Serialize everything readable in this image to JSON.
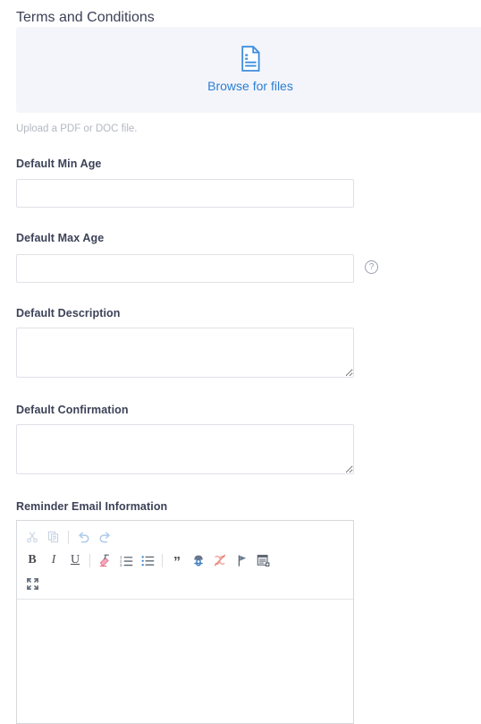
{
  "form": {
    "terms": {
      "label": "Terms and Conditions",
      "dropzone_label": "Browse for files",
      "dropzone_icon": "document-icon",
      "help_text": "Upload a PDF or DOC file.",
      "accent_color": "#2b7fd4",
      "dropzone_background": "#f4f5fa"
    },
    "min_age": {
      "label": "Default Min Age",
      "value": "",
      "placeholder": ""
    },
    "max_age": {
      "label": "Default Max Age",
      "value": "",
      "placeholder": "",
      "help_icon": "question-mark-circle-icon"
    },
    "description": {
      "label": "Default Description",
      "value": "",
      "placeholder": ""
    },
    "confirmation": {
      "label": "Default Confirmation",
      "value": "",
      "placeholder": ""
    },
    "reminder_email": {
      "label": "Reminder Email Information",
      "content": "",
      "toolbar": {
        "row1": [
          {
            "name": "cut-icon",
            "glyph": "✂",
            "title": "Cut",
            "disabled": true
          },
          {
            "name": "copy-icon",
            "glyph": "❐",
            "title": "Copy",
            "disabled": true
          },
          {
            "name": "separator",
            "glyph": "",
            "title": "",
            "disabled": true
          },
          {
            "name": "undo-icon",
            "glyph": "↶",
            "title": "Undo",
            "disabled": true
          },
          {
            "name": "redo-icon",
            "glyph": "↷",
            "title": "Redo",
            "disabled": true
          }
        ],
        "row2": [
          {
            "name": "bold-icon",
            "glyph": "B",
            "title": "Bold",
            "disabled": false
          },
          {
            "name": "italic-icon",
            "glyph": "I",
            "title": "Italic",
            "disabled": false
          },
          {
            "name": "underline-icon",
            "glyph": "U",
            "title": "Underline",
            "disabled": false
          },
          {
            "name": "separator",
            "glyph": "",
            "title": "",
            "disabled": false
          },
          {
            "name": "remove-format-icon",
            "glyph": "",
            "title": "Remove Format",
            "disabled": false
          },
          {
            "name": "numbered-list-icon",
            "glyph": "",
            "title": "Insert/Remove Numbered List",
            "disabled": false
          },
          {
            "name": "bulleted-list-icon",
            "glyph": "",
            "title": "Insert/Remove Bulleted List",
            "disabled": false
          },
          {
            "name": "separator",
            "glyph": "",
            "title": "",
            "disabled": false
          },
          {
            "name": "blockquote-icon",
            "glyph": "”",
            "title": "Block Quote",
            "disabled": false
          },
          {
            "name": "link-icon",
            "glyph": "",
            "title": "Link",
            "disabled": false
          },
          {
            "name": "unlink-icon",
            "glyph": "",
            "title": "Unlink",
            "disabled": false
          },
          {
            "name": "anchor-icon",
            "glyph": "",
            "title": "Anchor",
            "disabled": false
          },
          {
            "name": "page-break-icon",
            "glyph": "",
            "title": "Page Break",
            "disabled": false
          }
        ],
        "row3": [
          {
            "name": "maximize-icon",
            "glyph": "",
            "title": "Maximize",
            "disabled": false
          }
        ]
      }
    }
  }
}
